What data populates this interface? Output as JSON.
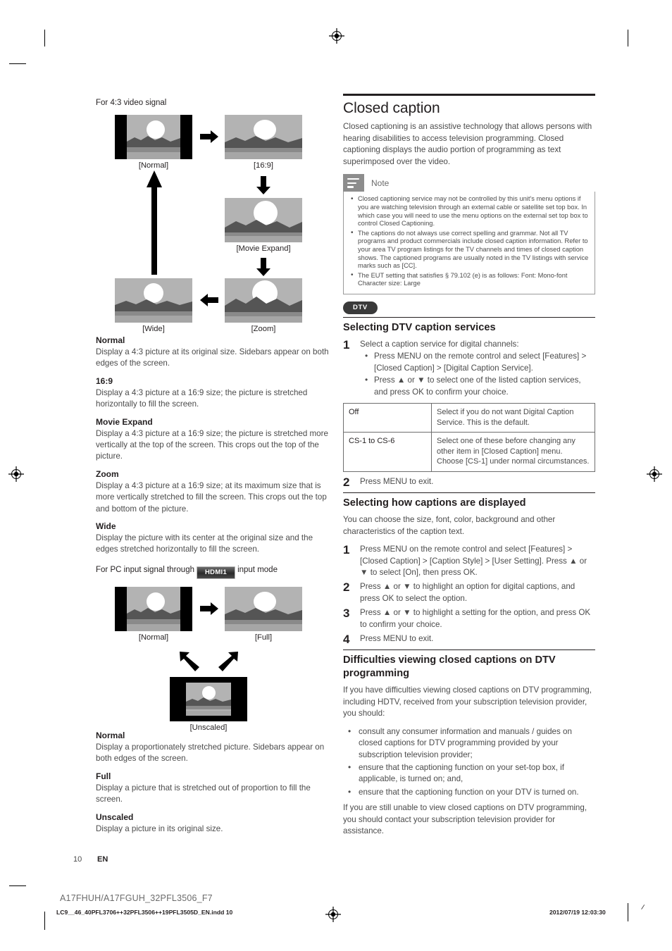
{
  "left_column": {
    "diagram1_title": "For 4:3 video signal",
    "diagram1_labels": {
      "normal": "[Normal]",
      "ratio169": "[16:9]",
      "movie_expand": "[Movie Expand]",
      "zoom": "[Zoom]",
      "wide": "[Wide]"
    },
    "modes": [
      {
        "name": "Normal",
        "desc": "Display a 4:3 picture at its original size. Sidebars appear on both edges of the screen."
      },
      {
        "name": "16:9",
        "desc": "Display a 4:3 picture at a 16:9 size; the picture is stretched horizontally to fill the screen."
      },
      {
        "name": "Movie Expand",
        "desc": "Display a 4:3 picture at a 16:9 size; the picture is stretched more vertically at the top of the screen. This crops out the top of the picture."
      },
      {
        "name": "Zoom",
        "desc": "Display a 4:3 picture at a 16:9 size; at its maximum size that is more vertically stretched to fill the screen. This crops out the top and bottom of the picture."
      },
      {
        "name": "Wide",
        "desc": "Display the picture with its center at the original size and the edges stretched horizontally to fill the screen."
      }
    ],
    "diagram2_title_before": "For PC input signal through",
    "diagram2_badge": "HDMI1",
    "diagram2_title_after": "input mode",
    "diagram2_labels": {
      "normal": "[Normal]",
      "full": "[Full]",
      "unscaled": "[Unscaled]"
    },
    "pc_modes": [
      {
        "name": "Normal",
        "desc": "Display a proportionately stretched picture. Sidebars appear on both edges of the screen."
      },
      {
        "name": "Full",
        "desc": "Display a picture that is stretched out of proportion to fill the screen."
      },
      {
        "name": "Unscaled",
        "desc": "Display a picture in its original size."
      }
    ]
  },
  "right_column": {
    "section_title": "Closed caption",
    "intro": "Closed captioning is an assistive technology that allows persons with hearing disabilities to access television programming. Closed captioning displays the audio portion of programming as text superimposed over the video.",
    "note": {
      "title": "Note",
      "items": [
        "Closed captioning service may not be controlled by this unit's menu options if you are watching television through an external cable or satellite set top box. In which case you will need to use the menu options on the external set top box to control Closed Captioning.",
        "The captions do not always use correct spelling and grammar. Not all TV programs and product commercials include closed caption information. Refer to your area TV program listings for the TV channels and times of closed caption shows. The captioned programs are usually noted in the TV listings with service marks such as [CC].",
        "The EUT setting that satisfies § 79.102 (e) is as follows: Font: Mono-font Character size: Large"
      ]
    },
    "dtv_badge": "DTV",
    "dtv_section_title": "Selecting DTV caption services",
    "dtv_step1_num": "1",
    "dtv_step1_text": "Select a caption service for digital channels:",
    "dtv_step1_bullets": [
      "Press MENU on the remote control and select [Features] > [Closed Caption] > [Digital Caption Service].",
      "Press ▲ or ▼ to select one of the listed caption services, and press OK to confirm your choice."
    ],
    "table": {
      "rows": [
        {
          "key": "Off",
          "value": "Select if you do not want Digital Caption Service. This is the default."
        },
        {
          "key": "CS-1 to CS-6",
          "value": "Select one of these before changing any other item in [Closed Caption] menu. Choose [CS-1] under normal circumstances."
        }
      ]
    },
    "dtv_step2_num": "2",
    "dtv_step2_text": "Press MENU to exit.",
    "display_section_title": "Selecting how captions are displayed",
    "display_intro": "You can choose the size, font, color, background and other characteristics of the caption text.",
    "display_steps": [
      {
        "num": "1",
        "text": "Press MENU on the remote control and select [Features] > [Closed Caption] > [Caption Style] > [User Setting]. Press ▲ or ▼ to select [On], then press OK."
      },
      {
        "num": "2",
        "text": "Press ▲ or ▼ to highlight an option for digital captions, and press OK to select the option."
      },
      {
        "num": "3",
        "text": "Press ▲ or ▼ to highlight a setting for the option, and press OK to confirm your choice."
      },
      {
        "num": "4",
        "text": "Press MENU to exit."
      }
    ],
    "difficulties_title": "Difficulties viewing closed captions on DTV programming",
    "difficulties_intro": "If you have difficulties viewing closed captions on DTV programming, including HDTV, received from your subscription television provider, you should:",
    "difficulties_bullets": [
      "consult any consumer information and manuals / guides on closed captions for DTV programming provided by your subscription television provider;",
      "ensure that the captioning function on your set-top box, if applicable, is turned on; and,",
      "ensure that the captioning function on your DTV is turned on."
    ],
    "difficulties_outro": "If you are still unable to view closed captions on DTV programming, you should contact your subscription television provider for assistance."
  },
  "footer": {
    "page_number": "10",
    "language": "EN",
    "model": "A17FHUH/A17FGUH_32PFL3506_F7",
    "filename": "LC9__46_40PFL3706++32PFL3506++19PFL3505D_EN.indd   10",
    "timestamp": "2012/07/19   12:03:30"
  }
}
